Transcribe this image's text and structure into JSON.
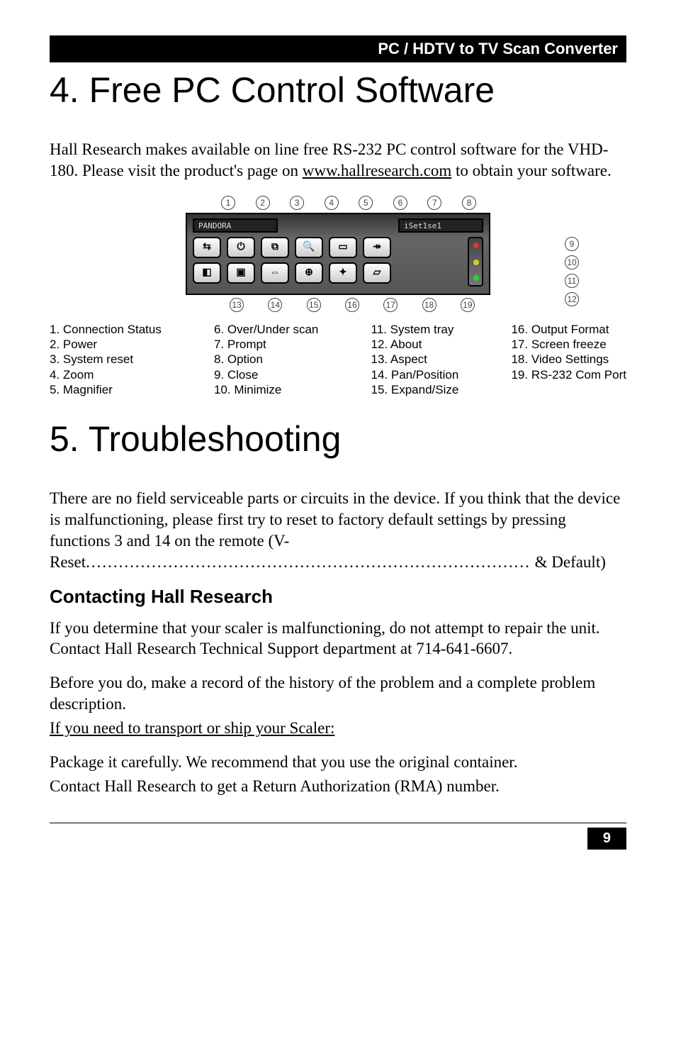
{
  "header": {
    "title": "PC / HDTV to TV Scan Converter"
  },
  "section4": {
    "title": "4. Free PC Control Software",
    "para_pre": "Hall Research makes available on line free RS-232 PC control software for the VHD-180. Please visit the product's page on ",
    "link": "www.hallresearch.com",
    "para_post": " to obtain your software."
  },
  "diagram": {
    "top_nums": [
      "1",
      "2",
      "3",
      "4",
      "5",
      "6",
      "7",
      "8"
    ],
    "right_nums": [
      "9",
      "10",
      "11",
      "12"
    ],
    "bottom_nums": [
      "13",
      "14",
      "15",
      "16",
      "17",
      "18",
      "19"
    ],
    "lcd_left": "PANDORA",
    "lcd_right": "iSet1se1"
  },
  "legend": {
    "col1": {
      "l1": "1. Connection Status",
      "l2": "2. Power",
      "l3": "3. System reset",
      "l4": "4. Zoom",
      "l5": "5. Magnifier"
    },
    "col2": {
      "l1": "6. Over/Under scan",
      "l2": "7. Prompt",
      "l3": "8. Option",
      "l4": "9. Close",
      "l5": "10. Minimize"
    },
    "col3": {
      "l1": "11. System tray",
      "l2": "12. About",
      "l3": "13. Aspect",
      "l4": "14. Pan/Position",
      "l5": "15. Expand/Size"
    },
    "col4": {
      "l1": "16. Output Format",
      "l2": "17. Screen freeze",
      "l3": "18. Video Settings",
      "l4": "19. RS-232 Com Port"
    }
  },
  "section5": {
    "title": "5. Troubleshooting",
    "para1_a": "There are no field serviceable parts or circuits in the device. If you think that the device is malfunctioning, please first try to reset to factory default settings by pressing functions 3 and 14 on the remote (V-Reset",
    "dots": ".................................................................................",
    "para1_b": " & Default)",
    "sub_heading": "Contacting Hall Research",
    "para2": "If you determine that your scaler is malfunctioning, do not attempt to repair the unit. Contact Hall Research Technical Support department at 714-641-6607.",
    "para3": "Before you do, make a record of the history of the problem and a complete problem description.",
    "ship_heading": "If you need to transport or ship your Scaler:",
    "para4": "Package it carefully. We recommend that you use the original container.",
    "para5": "Contact Hall Research to get a Return Authorization (RMA) number."
  },
  "footer": {
    "page": "9"
  }
}
